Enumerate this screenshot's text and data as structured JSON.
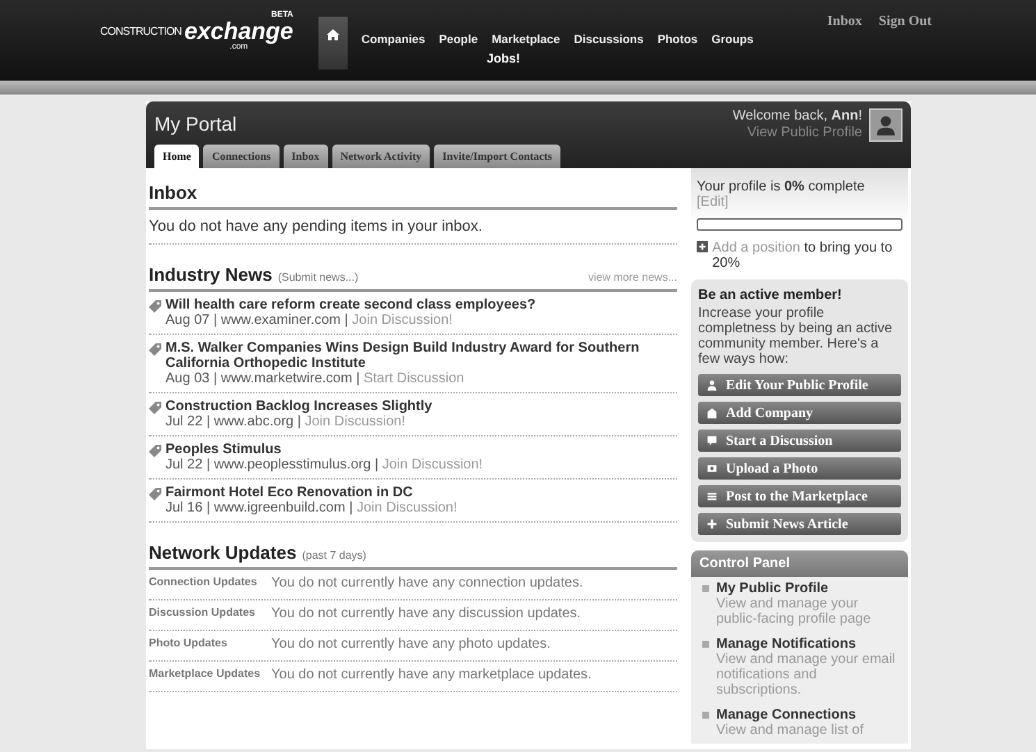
{
  "header": {
    "logo": {
      "prefix": "CONSTRUCTION",
      "brand": "exchange",
      "domain": ".com",
      "badge": "BETA"
    },
    "nav": [
      {
        "kind": "home",
        "selected": true
      },
      {
        "kind": "text",
        "label": "Companies",
        "selected": false
      },
      {
        "kind": "text",
        "label": "People",
        "selected": false
      },
      {
        "kind": "text",
        "label": "Marketplace",
        "selected": false
      },
      {
        "kind": "text",
        "label": "Discussions",
        "selected": false
      },
      {
        "kind": "text",
        "label": "Photos",
        "selected": false
      },
      {
        "kind": "text",
        "label": "Groups",
        "selected": false
      }
    ],
    "subnav": "Jobs!",
    "user_links": [
      "Inbox",
      "Sign Out"
    ]
  },
  "portal": {
    "title": "My Portal",
    "tabs": [
      {
        "label": "Home",
        "selected": true
      },
      {
        "label": "Connections",
        "selected": false
      },
      {
        "label": "Inbox",
        "selected": false
      },
      {
        "label": "Network Activity",
        "selected": false
      },
      {
        "label": "Invite/Import Contacts",
        "selected": false
      }
    ],
    "welcome": "Welcome back, **Ann**!",
    "profile_link": "View Public Profile"
  },
  "inbox": {
    "title": "Inbox",
    "message": "You do not have any pending items in your inbox."
  },
  "industry_news": {
    "title": "Industry News",
    "submit_link": "(Submit news...)",
    "more_link": "view more news...",
    "separator": "|",
    "items": [
      {
        "title": "Will health care reform create second class employees?",
        "date": "Aug 07",
        "source": "www.examiner.com",
        "action": "Join Discussion!"
      },
      {
        "title": "M.S. Walker Companies Wins Design Build Industry Award for Southern California Orthopedic Institute",
        "date": "Aug 03",
        "source": "www.marketwire.com",
        "action": "Start Discussion"
      },
      {
        "title": "Construction Backlog Increases Slightly",
        "date": "Jul 22",
        "source": "www.abc.org",
        "action": "Join Discussion!"
      },
      {
        "title": "Peoples Stimulus",
        "date": "Jul 22",
        "source": "www.peoplesstimulus.org",
        "action": "Join Discussion!"
      },
      {
        "title": "Fairmont Hotel Eco Renovation in DC",
        "date": "Jul 16",
        "source": "www.igreenbuild.com",
        "action": "Join Discussion!"
      }
    ]
  },
  "network_updates": {
    "title": "Network Updates",
    "period": "(past 7 days)",
    "rows": [
      {
        "label": "Connection Updates",
        "message": "You do not currently have any connection updates."
      },
      {
        "label": "Discussion Updates",
        "message": "You do not currently have any discussion updates."
      },
      {
        "label": "Photo Updates",
        "message": "You do not currently have any photo updates."
      },
      {
        "label": "Marketplace Updates",
        "message": "You do not currently have any marketplace updates."
      }
    ]
  },
  "profile": {
    "completion": "Your profile is **0%** complete",
    "edit_link": "[Edit]",
    "level": 0,
    "add_link": "Add a position",
    "add_suffix": "to bring you to 20%"
  },
  "active_member": {
    "title": "Be an active member!",
    "text": "Increase your profile completness by being an active community member. Here's a few ways how:",
    "buttons": [
      {
        "kind": "person",
        "label": "Edit Your Public Profile"
      },
      {
        "kind": "building",
        "label": "Add Company"
      },
      {
        "kind": "speech",
        "label": "Start a Discussion"
      },
      {
        "kind": "photo",
        "label": "Upload a Photo"
      },
      {
        "kind": "list",
        "label": "Post to the Marketplace"
      },
      {
        "kind": "plus",
        "label": "Submit News Article"
      }
    ]
  },
  "control_panel": {
    "title": "Control Panel",
    "items": [
      {
        "title": "My Public Profile",
        "description": "View and manage your public-facing profile page"
      },
      {
        "title": "Manage Notifications",
        "description": "View and manage your email notifications and subscriptions."
      },
      {
        "title": "Manage Connections",
        "description": "View and manage list of"
      }
    ]
  }
}
